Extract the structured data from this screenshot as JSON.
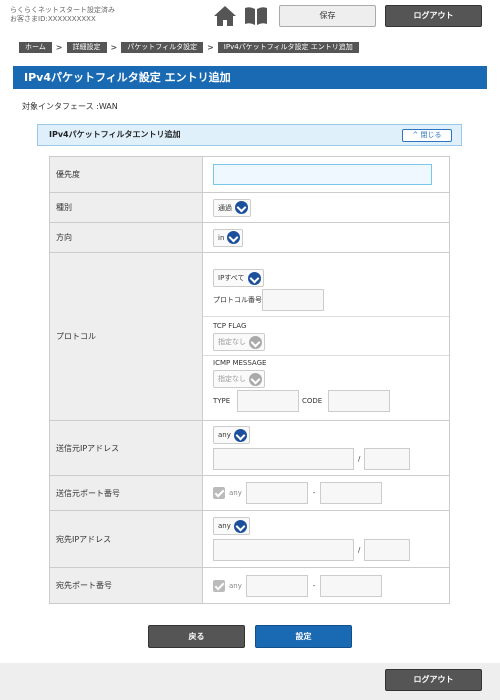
{
  "header": {
    "status_line1": "らくらくネットスタート設定済み",
    "status_line2": "お客さまID:XXXXXXXXXX",
    "home_icon": "home-icon",
    "manual_icon": "book-icon",
    "save_label": "保存",
    "logout_label": "ログアウト"
  },
  "breadcrumb": [
    "ホーム",
    "詳細設定",
    "パケットフィルタ設定",
    "IPv4パケットフィルタ設定 エントリ追加"
  ],
  "page_title": "IPv4パケットフィルタ設定 エントリ追加",
  "interface_text": "対象インタフェース :WAN",
  "section": {
    "title": "IPv4パケットフィルタエントリ追加",
    "close_label": "閉じる"
  },
  "form": {
    "priority": {
      "label": "優先度",
      "value": ""
    },
    "type": {
      "label": "種別",
      "selected": "通過"
    },
    "direction": {
      "label": "方向",
      "selected": "in"
    },
    "protocol": {
      "label": "プロトコル",
      "selected": "IPすべて",
      "protocol_number_label": "プロトコル番号",
      "tcp_flag_label": "TCP FLAG",
      "tcp_flag_selected": "指定なし",
      "icmp_message_label": "ICMP MESSAGE",
      "icmp_message_selected": "指定なし",
      "type_label": "TYPE",
      "code_label": "CODE"
    },
    "src_ip": {
      "label": "送信元IPアドレス",
      "selected": "any",
      "slash": "/"
    },
    "src_port": {
      "label": "送信元ポート番号",
      "any_label": "any",
      "dash": "-"
    },
    "dst_ip": {
      "label": "宛先IPアドレス",
      "selected": "any",
      "slash": "/"
    },
    "dst_port": {
      "label": "宛先ポート番号",
      "any_label": "any",
      "dash": "-"
    }
  },
  "buttons": {
    "back": "戻る",
    "apply": "設定"
  },
  "footer": {
    "logout_label": "ログアウト"
  },
  "colors": {
    "primary": "#1a6ab3",
    "dark_button": "#555555",
    "section_bg": "#dff0fb"
  }
}
